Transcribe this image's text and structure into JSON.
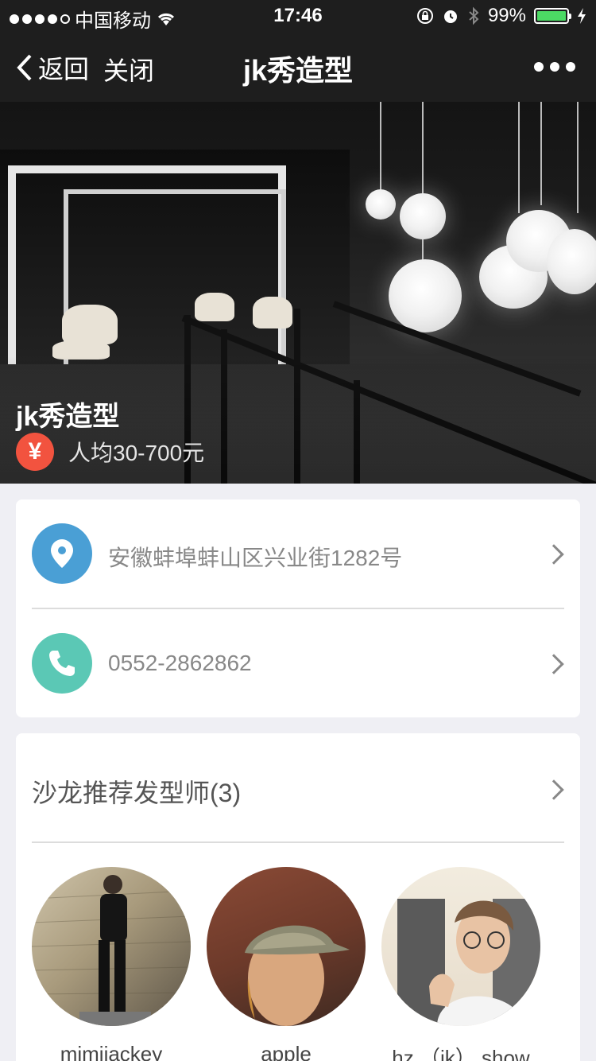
{
  "status_bar": {
    "carrier": "中国移动",
    "time": "17:46",
    "battery": "99%",
    "battery_level": 0.99,
    "icons": [
      "signal-dots-icon",
      "wifi-icon",
      "rotation-lock-icon",
      "alarm-icon",
      "bluetooth-icon",
      "battery-icon",
      "charging-icon"
    ]
  },
  "nav": {
    "back_label": "返回",
    "close_label": "关闭",
    "title": "jk秀造型",
    "more_icon": "more-dots-icon"
  },
  "hero": {
    "salon_name": "jk秀造型",
    "price_symbol": "¥",
    "price_text": "人均30-700元"
  },
  "info": {
    "address": "安徽蚌埠蚌山区兴业街1282号",
    "address_icon": "location-pin-icon",
    "address_color": "#4a9fd5",
    "phone": "0552-2862862",
    "phone_icon": "phone-icon",
    "phone_color": "#5bc8b5"
  },
  "stylists": {
    "heading": "沙龙推荐发型师(3)",
    "items": [
      {
        "name": "mimijackey"
      },
      {
        "name": "apple"
      },
      {
        "name": "hz （jk） show"
      }
    ]
  },
  "colors": {
    "nav_bg": "#1e1e1e",
    "page_bg": "#efeff4",
    "price_badge": "#f2533f"
  }
}
